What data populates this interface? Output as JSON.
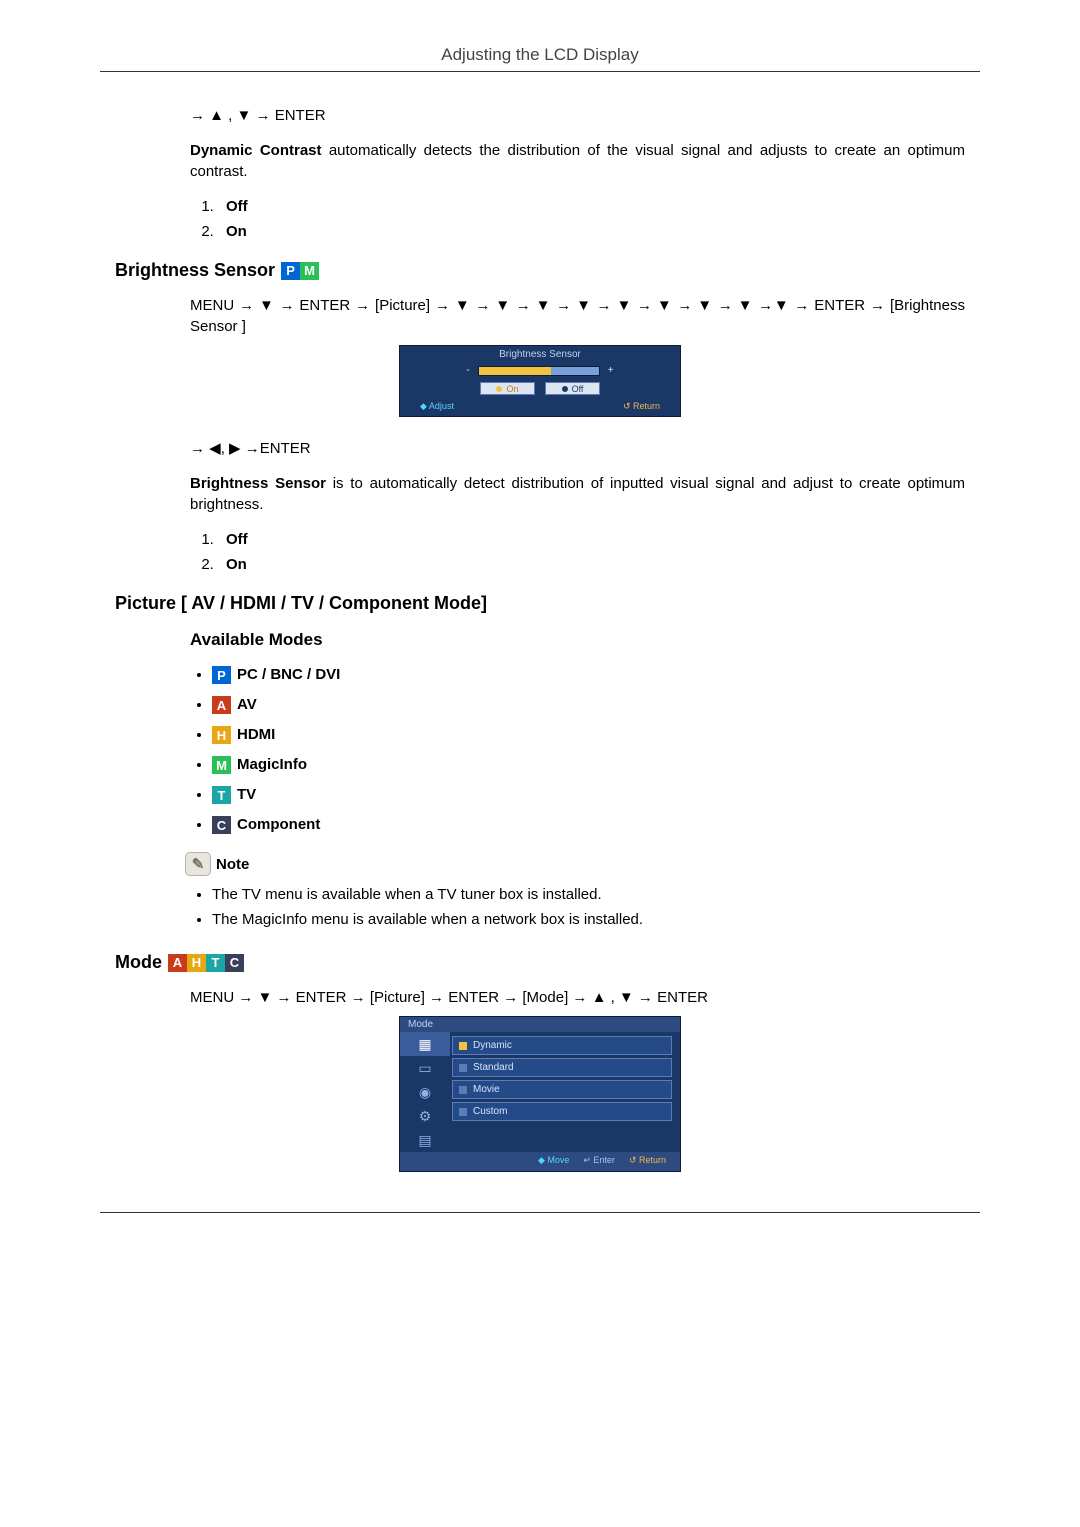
{
  "header": {
    "title": "Adjusting the LCD Display"
  },
  "dynamic_contrast": {
    "nav": "→ ▲ , ▼ → ENTER",
    "bold_name": "Dynamic Contrast",
    "para_rest": " automatically detects the distribution of the visual signal and adjusts to create an optimum contrast.",
    "items": [
      "Off",
      "On"
    ]
  },
  "brightness_sensor": {
    "heading": "Brightness Sensor",
    "badges": [
      "P",
      "M"
    ],
    "menu_path": "MENU → ▼ → ENTER → [Picture] → ▼ → ▼ → ▼ → ▼ → ▼ → ▼ → ▼ → ▼ →▼ → ENTER → [Brightness Sensor ]",
    "osd": {
      "title": "Brightness Sensor",
      "btn_on": "On",
      "btn_off": "Off",
      "footer_left": "◆ Adjust",
      "footer_right": "↺ Return"
    },
    "nav2": "→ ◀, ▶ →ENTER",
    "bold_name": "Brightness Sensor",
    "para_rest": " is to automatically detect distribution of inputted visual signal and adjust to create optimum brightness.",
    "items": [
      "Off",
      "On"
    ]
  },
  "picture_section": {
    "heading": "Picture [ AV / HDMI / TV / Component Mode]",
    "available_modes_heading": "Available Modes",
    "modes": [
      {
        "badge": "P",
        "label": "PC / BNC / DVI"
      },
      {
        "badge": "A",
        "label": "AV"
      },
      {
        "badge": "H",
        "label": "HDMI"
      },
      {
        "badge": "M",
        "label": "MagicInfo"
      },
      {
        "badge": "T",
        "label": "TV"
      },
      {
        "badge": "C",
        "label": "Component"
      }
    ],
    "note_label": "Note",
    "notes": [
      "The TV menu is available when a TV tuner box is installed.",
      "The MagicInfo menu is available when a network box is installed."
    ]
  },
  "mode_section": {
    "heading": "Mode",
    "badges": [
      "A",
      "H",
      "T",
      "C"
    ],
    "menu_path": "MENU → ▼ → ENTER → [Picture] → ENTER → [Mode] → ▲ , ▼ → ENTER",
    "osd": {
      "title": "Mode",
      "options": [
        "Dynamic",
        "Standard",
        "Movie",
        "Custom"
      ],
      "footer_move": "◆ Move",
      "footer_enter": "↵ Enter",
      "footer_return": "↺ Return"
    }
  }
}
